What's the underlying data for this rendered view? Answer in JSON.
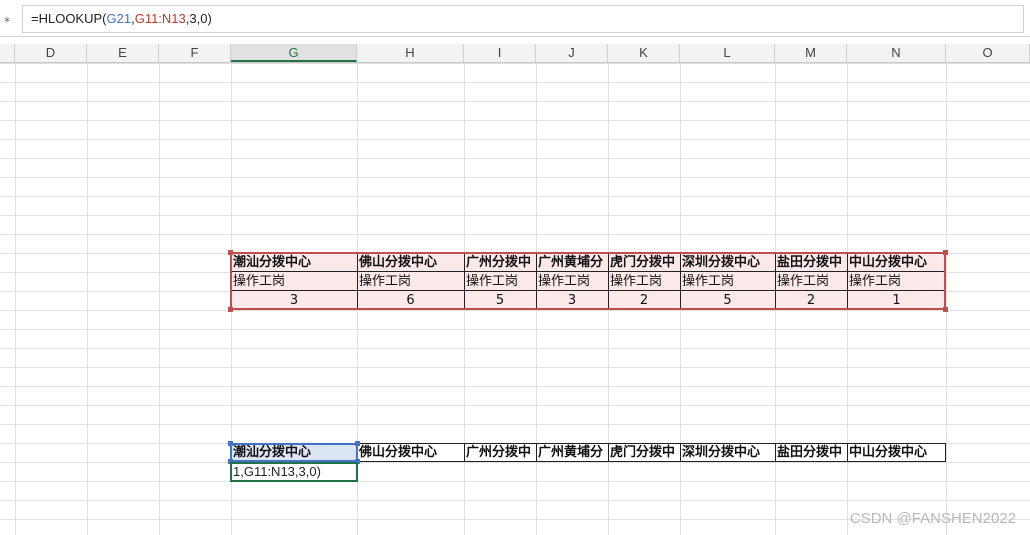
{
  "formula_bar": {
    "prefix": "=HLOOKUP(",
    "ref1": "G21",
    "sep": ",",
    "ref2": "G11:N13",
    "suffix": ",3,0)"
  },
  "columns": [
    "D",
    "E",
    "F",
    "G",
    "H",
    "I",
    "J",
    "K",
    "L",
    "M",
    "N",
    "O"
  ],
  "active_column": "G",
  "table1": {
    "headers": [
      "潮汕分拨中心",
      "佛山分拨中心",
      "广州分拨中",
      "广州黄埔分",
      "虎门分拨中",
      "深圳分拨中心",
      "盐田分拨中",
      "中山分拨中心"
    ],
    "subrow": [
      "操作工岗",
      "操作工岗",
      "操作工岗",
      "操作工岗",
      "操作工岗",
      "操作工岗",
      "操作工岗",
      "操作工岗"
    ],
    "values": [
      "3",
      "6",
      "5",
      "3",
      "2",
      "5",
      "2",
      "1"
    ]
  },
  "table2": {
    "headers": [
      "潮汕分拨中心",
      "佛山分拨中心",
      "广州分拨中",
      "广州黄埔分",
      "虎门分拨中",
      "深圳分拨中心",
      "盐田分拨中",
      "中山分拨中心"
    ]
  },
  "edit_cell": "1,G11:N13,3,0)",
  "watermark": "CSDN @FANSHEN2022",
  "colors": {
    "range_border": "#c0504d",
    "ref_border": "#4472c4",
    "active_green": "#217346"
  }
}
